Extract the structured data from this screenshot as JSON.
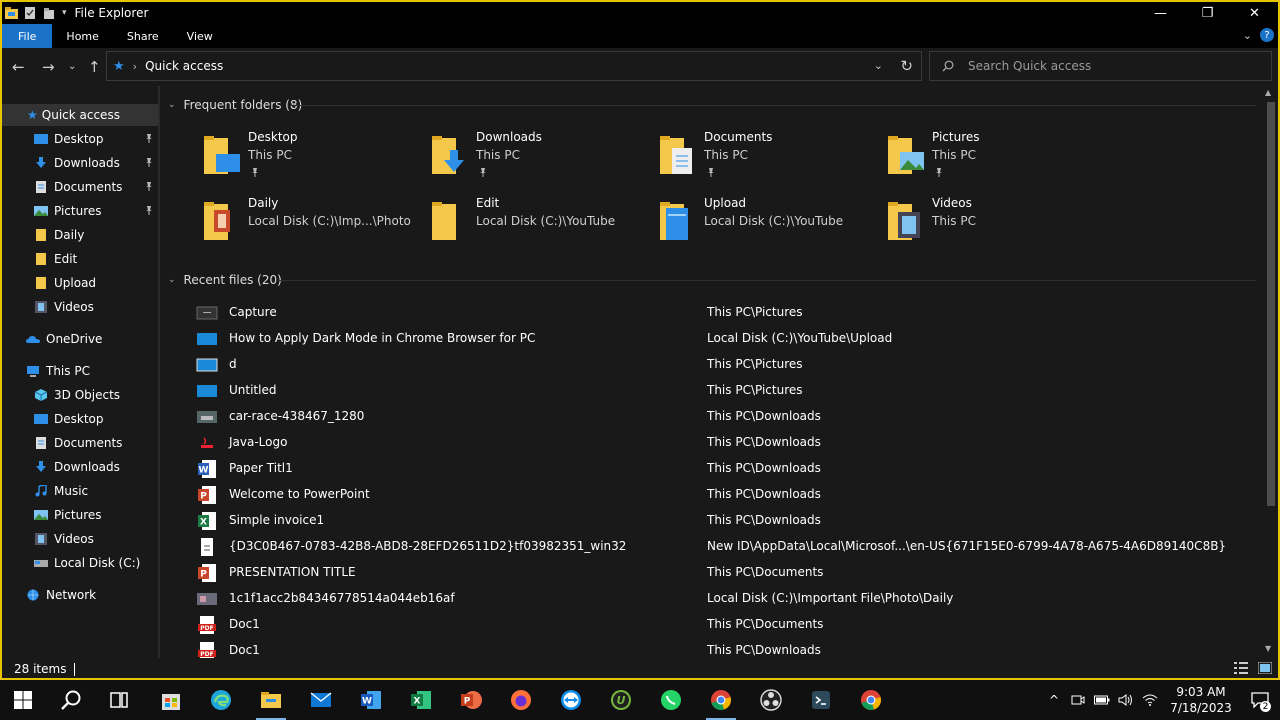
{
  "window": {
    "title": "File Explorer",
    "controls": {
      "minimize": "—",
      "maximize": "❐",
      "close": "✕"
    }
  },
  "ribbon": {
    "tabs": [
      {
        "label": "File",
        "active": true
      },
      {
        "label": "Home"
      },
      {
        "label": "Share"
      },
      {
        "label": "View"
      }
    ],
    "help": "?"
  },
  "address": {
    "path": "Quick access",
    "search_placeholder": "Search Quick access"
  },
  "nav": {
    "quick_access": "Quick access",
    "quick_items": [
      {
        "label": "Desktop",
        "icon": "desktop-icon",
        "pinned": true
      },
      {
        "label": "Downloads",
        "icon": "downloads-icon",
        "pinned": true
      },
      {
        "label": "Documents",
        "icon": "documents-icon",
        "pinned": true
      },
      {
        "label": "Pictures",
        "icon": "pictures-icon",
        "pinned": true
      },
      {
        "label": "Daily",
        "icon": "folder-icon"
      },
      {
        "label": "Edit",
        "icon": "folder-icon"
      },
      {
        "label": "Upload",
        "icon": "folder-icon"
      },
      {
        "label": "Videos",
        "icon": "videos-icon"
      }
    ],
    "onedrive": "OneDrive",
    "this_pc": "This PC",
    "pc_items": [
      {
        "label": "3D Objects",
        "icon": "3d-objects-icon"
      },
      {
        "label": "Desktop",
        "icon": "desktop-icon"
      },
      {
        "label": "Documents",
        "icon": "documents-icon"
      },
      {
        "label": "Downloads",
        "icon": "downloads-icon"
      },
      {
        "label": "Music",
        "icon": "music-icon"
      },
      {
        "label": "Pictures",
        "icon": "pictures-icon"
      },
      {
        "label": "Videos",
        "icon": "videos-icon"
      },
      {
        "label": "Local Disk (C:)",
        "icon": "local-disk-icon"
      }
    ],
    "network": "Network"
  },
  "frequent": {
    "header": "Frequent folders (8)",
    "items": [
      {
        "name": "Desktop",
        "location": "This PC",
        "pinned": true,
        "icon": "desktop-folder-icon"
      },
      {
        "name": "Downloads",
        "location": "This PC",
        "pinned": true,
        "icon": "downloads-folder-icon"
      },
      {
        "name": "Documents",
        "location": "This PC",
        "pinned": true,
        "icon": "documents-folder-icon"
      },
      {
        "name": "Pictures",
        "location": "This PC",
        "pinned": true,
        "icon": "pictures-folder-icon"
      },
      {
        "name": "Daily",
        "location": "Local Disk (C:)\\Imp...\\Photo",
        "icon": "daily-folder-icon"
      },
      {
        "name": "Edit",
        "location": "Local Disk (C:)\\YouTube",
        "icon": "edit-folder-icon"
      },
      {
        "name": "Upload",
        "location": "Local Disk (C:)\\YouTube",
        "icon": "upload-folder-icon"
      },
      {
        "name": "Videos",
        "location": "This PC",
        "icon": "videos-folder-icon"
      }
    ]
  },
  "recent": {
    "header": "Recent files (20)",
    "items": [
      {
        "name": "Capture",
        "path": "This PC\\Pictures",
        "icon": "image-file-icon"
      },
      {
        "name": "How to Apply Dark Mode in Chrome Browser for PC",
        "path": "Local Disk (C:)\\YouTube\\Upload",
        "icon": "image-file-icon"
      },
      {
        "name": "d",
        "path": "This PC\\Pictures",
        "icon": "image-file-icon"
      },
      {
        "name": "Untitled",
        "path": "This PC\\Pictures",
        "icon": "image-file-icon"
      },
      {
        "name": "car-race-438467_1280",
        "path": "This PC\\Downloads",
        "icon": "photo-file-icon"
      },
      {
        "name": "Java-Logo",
        "path": "This PC\\Downloads",
        "icon": "java-file-icon"
      },
      {
        "name": "Paper Titl1",
        "path": "This PC\\Downloads",
        "icon": "word-file-icon"
      },
      {
        "name": "Welcome to PowerPoint",
        "path": "This PC\\Downloads",
        "icon": "powerpoint-file-icon"
      },
      {
        "name": "Simple invoice1",
        "path": "This PC\\Downloads",
        "icon": "excel-file-icon"
      },
      {
        "name": "{D3C0B467-0783-42B8-ABD8-28EFD26511D2}tf03982351_win32",
        "path": "New ID\\AppData\\Local\\Microsof...\\en-US{671F15E0-6799-4A78-A675-4A6D89140C8B}",
        "icon": "generic-file-icon"
      },
      {
        "name": "PRESENTATION TITLE",
        "path": "This PC\\Documents",
        "icon": "powerpoint-file-icon"
      },
      {
        "name": "1c1f1acc2b84346778514a044eb16af",
        "path": "Local Disk (C:)\\Important File\\Photo\\Daily",
        "icon": "photo-file-icon"
      },
      {
        "name": "Doc1",
        "path": "This PC\\Documents",
        "icon": "pdf-file-icon"
      },
      {
        "name": "Doc1",
        "path": "This PC\\Downloads",
        "icon": "pdf-file-icon"
      }
    ]
  },
  "status": {
    "count": "28 items"
  },
  "taskbar": {
    "time": "9:03 AM",
    "date": "7/18/2023",
    "notifications": "2"
  },
  "colors": {
    "accent": "#1a73c7",
    "folder": "#f3c84b",
    "frame_border": "#e8c300",
    "background": "#191919"
  }
}
